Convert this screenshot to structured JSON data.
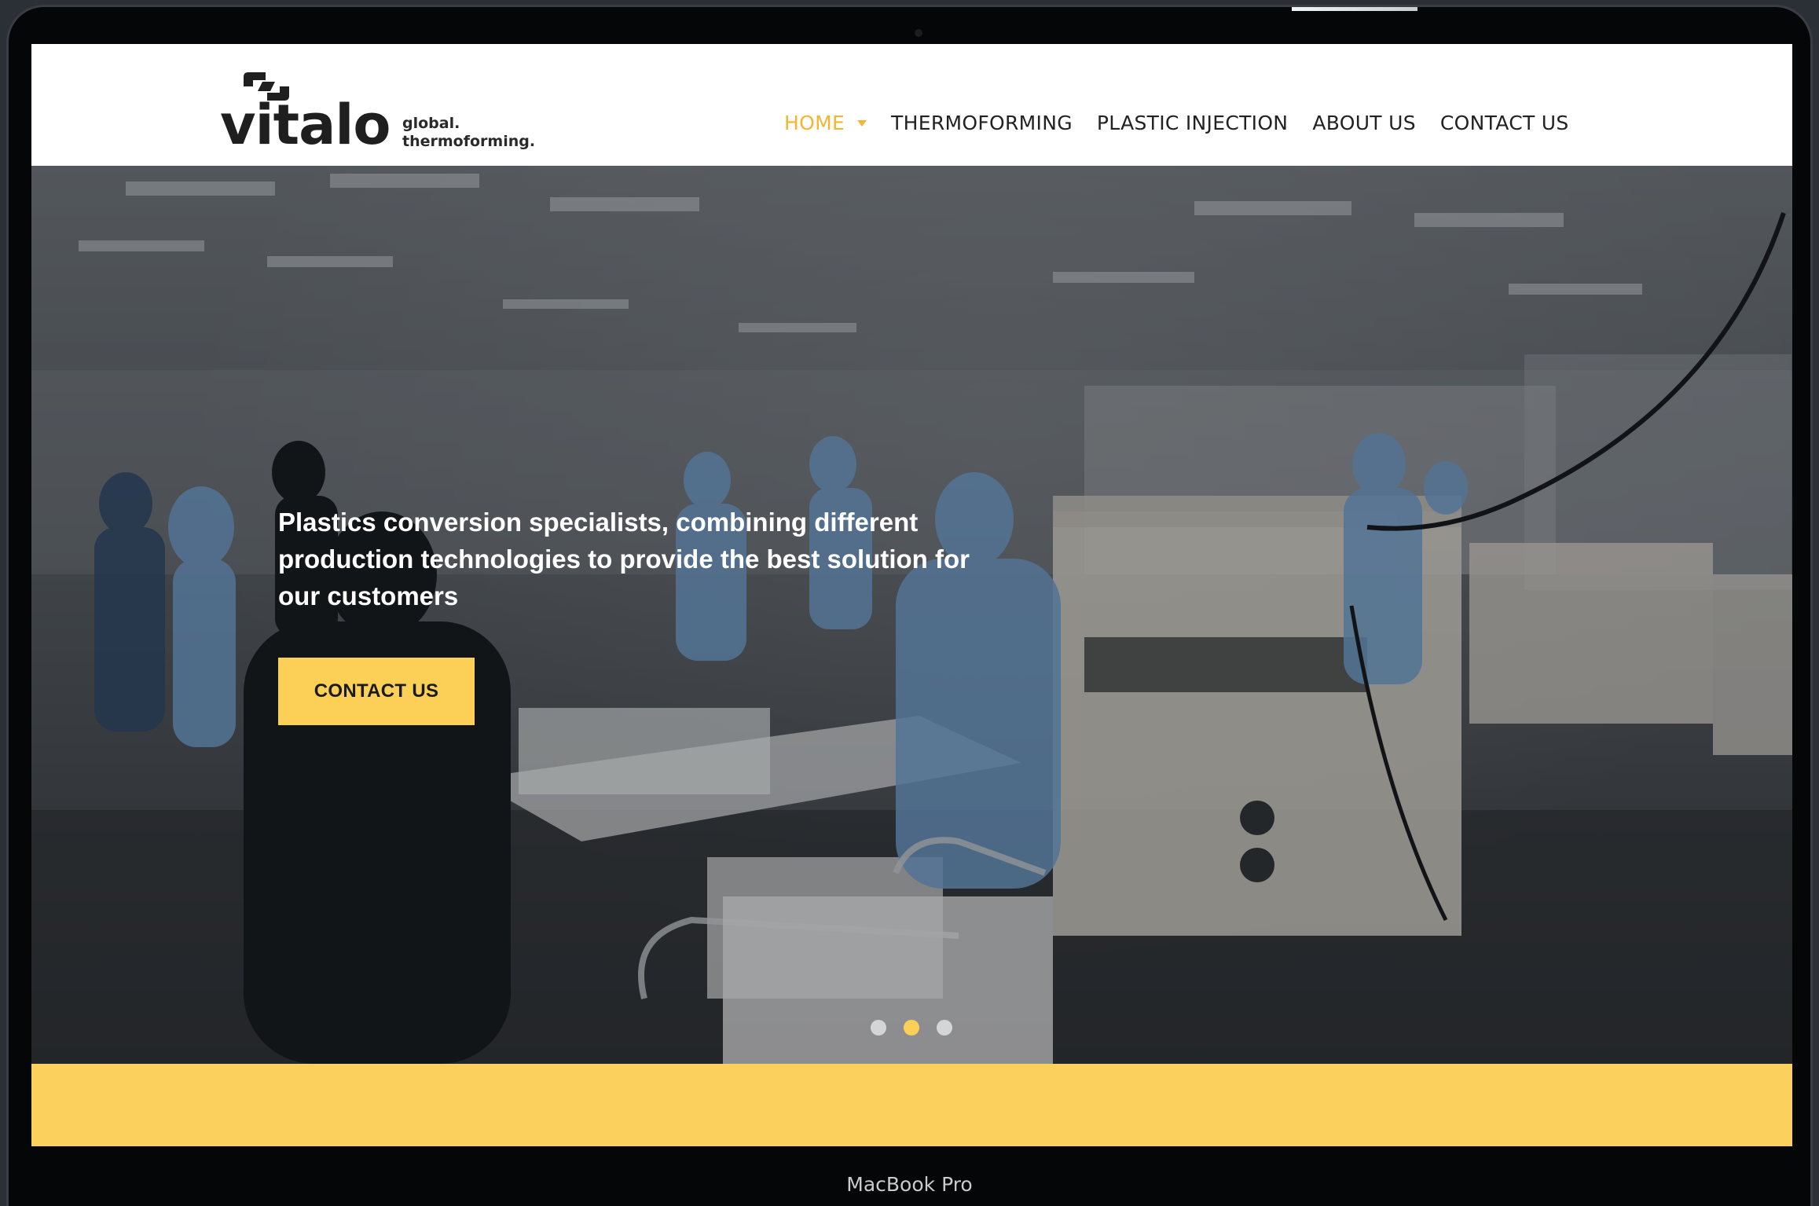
{
  "device": {
    "label": "MacBook Pro"
  },
  "brand": {
    "name": "vitalo",
    "tagline_line1": "global.",
    "tagline_line2": "thermoforming."
  },
  "nav": {
    "items": [
      {
        "label": "HOME",
        "active": true,
        "has_dropdown": true
      },
      {
        "label": "THERMOFORMING",
        "active": false
      },
      {
        "label": "PLASTIC INJECTION",
        "active": false
      },
      {
        "label": "ABOUT US",
        "active": false
      },
      {
        "label": "CONTACT US",
        "active": false
      }
    ]
  },
  "hero": {
    "headline": "Plastics conversion specialists, combining different production technologies to provide the best solution for our customers",
    "cta_label": "CONTACT US",
    "slider": {
      "total": 3,
      "active_index": 2
    }
  },
  "colors": {
    "accent": "#fccf57",
    "nav_active": "#f2b632",
    "header_bg": "#ffffff",
    "text_dark": "#222222"
  },
  "icons": {
    "logo_mark": "vitalo-logo-mark-icon",
    "dropdown": "caret-down-icon"
  }
}
